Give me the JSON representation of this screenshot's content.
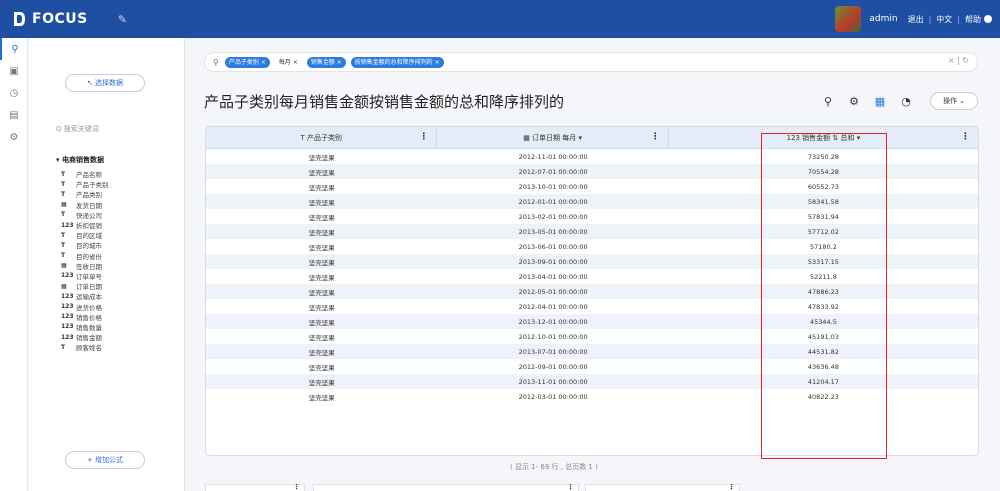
{
  "app": {
    "name": "FOCUS"
  },
  "user": {
    "name": "admin",
    "logout": "退出",
    "lang": "中文",
    "help": "帮助"
  },
  "left": {
    "select_data": "↖ 选择数据",
    "search_placeholder": "Q 搜索关键词",
    "root": "▾  电商销售数据",
    "fields": [
      {
        "type": "T",
        "label": "产品名称"
      },
      {
        "type": "T",
        "label": "产品子类别"
      },
      {
        "type": "T",
        "label": "产品类别"
      },
      {
        "type": "▦",
        "label": "发货日期"
      },
      {
        "type": "T",
        "label": "快递公司"
      },
      {
        "type": "123",
        "label": "折扣促销"
      },
      {
        "type": "T",
        "label": "目的区域"
      },
      {
        "type": "T",
        "label": "目的城市"
      },
      {
        "type": "T",
        "label": "目的省份"
      },
      {
        "type": "▦",
        "label": "签收日期"
      },
      {
        "type": "123",
        "label": "订单单号"
      },
      {
        "type": "▦",
        "label": "订单日期"
      },
      {
        "type": "123",
        "label": "运输成本"
      },
      {
        "type": "123",
        "label": "进货价格"
      },
      {
        "type": "123",
        "label": "销售价格"
      },
      {
        "type": "123",
        "label": "销售数量"
      },
      {
        "type": "123",
        "label": "销售金额"
      },
      {
        "type": "T",
        "label": "顾客姓名"
      }
    ],
    "add_formula": "+ 增加公式"
  },
  "search": {
    "tags": [
      {
        "label": "产品子类别 ×",
        "style": "blue"
      },
      {
        "label": "每月 ×",
        "style": "plain"
      },
      {
        "label": "销售金额 ×",
        "style": "blue"
      },
      {
        "label": "按销售金额的总和降序排列的 ×",
        "style": "blue"
      }
    ],
    "right": "× | ↻"
  },
  "main": {
    "title": "产品子类别每月销售金额按销售金额的总和降序排列的",
    "op_button": "操作 ⌄",
    "footer": "( 显示 1- 69 行 , 总页数 1 )"
  },
  "table": {
    "headers": [
      {
        "label": "T  产品子类别"
      },
      {
        "label": "▦  订单日期 每月 ▾"
      },
      {
        "label": "123  销售金额 ⇅ 总和 ▾"
      }
    ],
    "rows": [
      [
        "坚壳坚果",
        "2012-11-01 00:00:00",
        "73250.28"
      ],
      [
        "坚壳坚果",
        "2012-07-01 00:00:00",
        "70554.28"
      ],
      [
        "坚壳坚果",
        "2013-10-01 00:00:00",
        "60552.73"
      ],
      [
        "坚壳坚果",
        "2012-01-01 00:00:00",
        "58341.58"
      ],
      [
        "坚壳坚果",
        "2013-02-01 00:00:00",
        "57831.94"
      ],
      [
        "坚壳坚果",
        "2013-05-01 00:00:00",
        "57712.02"
      ],
      [
        "坚壳坚果",
        "2013-06-01 00:00:00",
        "57180.2"
      ],
      [
        "坚壳坚果",
        "2013-09-01 00:00:00",
        "53317.15"
      ],
      [
        "坚壳坚果",
        "2013-04-01 00:00:00",
        "52211.8"
      ],
      [
        "坚壳坚果",
        "2012-05-01 00:00:00",
        "47886.23"
      ],
      [
        "坚壳坚果",
        "2012-04-01 00:00:00",
        "47833.92"
      ],
      [
        "坚壳坚果",
        "2013-12-01 00:00:00",
        "45344.5"
      ],
      [
        "坚壳坚果",
        "2012-10-01 00:00:00",
        "45191.03"
      ],
      [
        "坚壳坚果",
        "2013-07-01 00:00:00",
        "44531.82"
      ],
      [
        "坚壳坚果",
        "2012-09-01 00:00:00",
        "43636.48"
      ],
      [
        "坚壳坚果",
        "2013-11-01 00:00:00",
        "41204.17"
      ],
      [
        "坚壳坚果",
        "2012-03-01 00:00:00",
        "40822.23"
      ]
    ]
  },
  "colors": {
    "topbar": "#1f4fa3",
    "accent": "#2d7ae0",
    "highlight": "#e0231e"
  }
}
